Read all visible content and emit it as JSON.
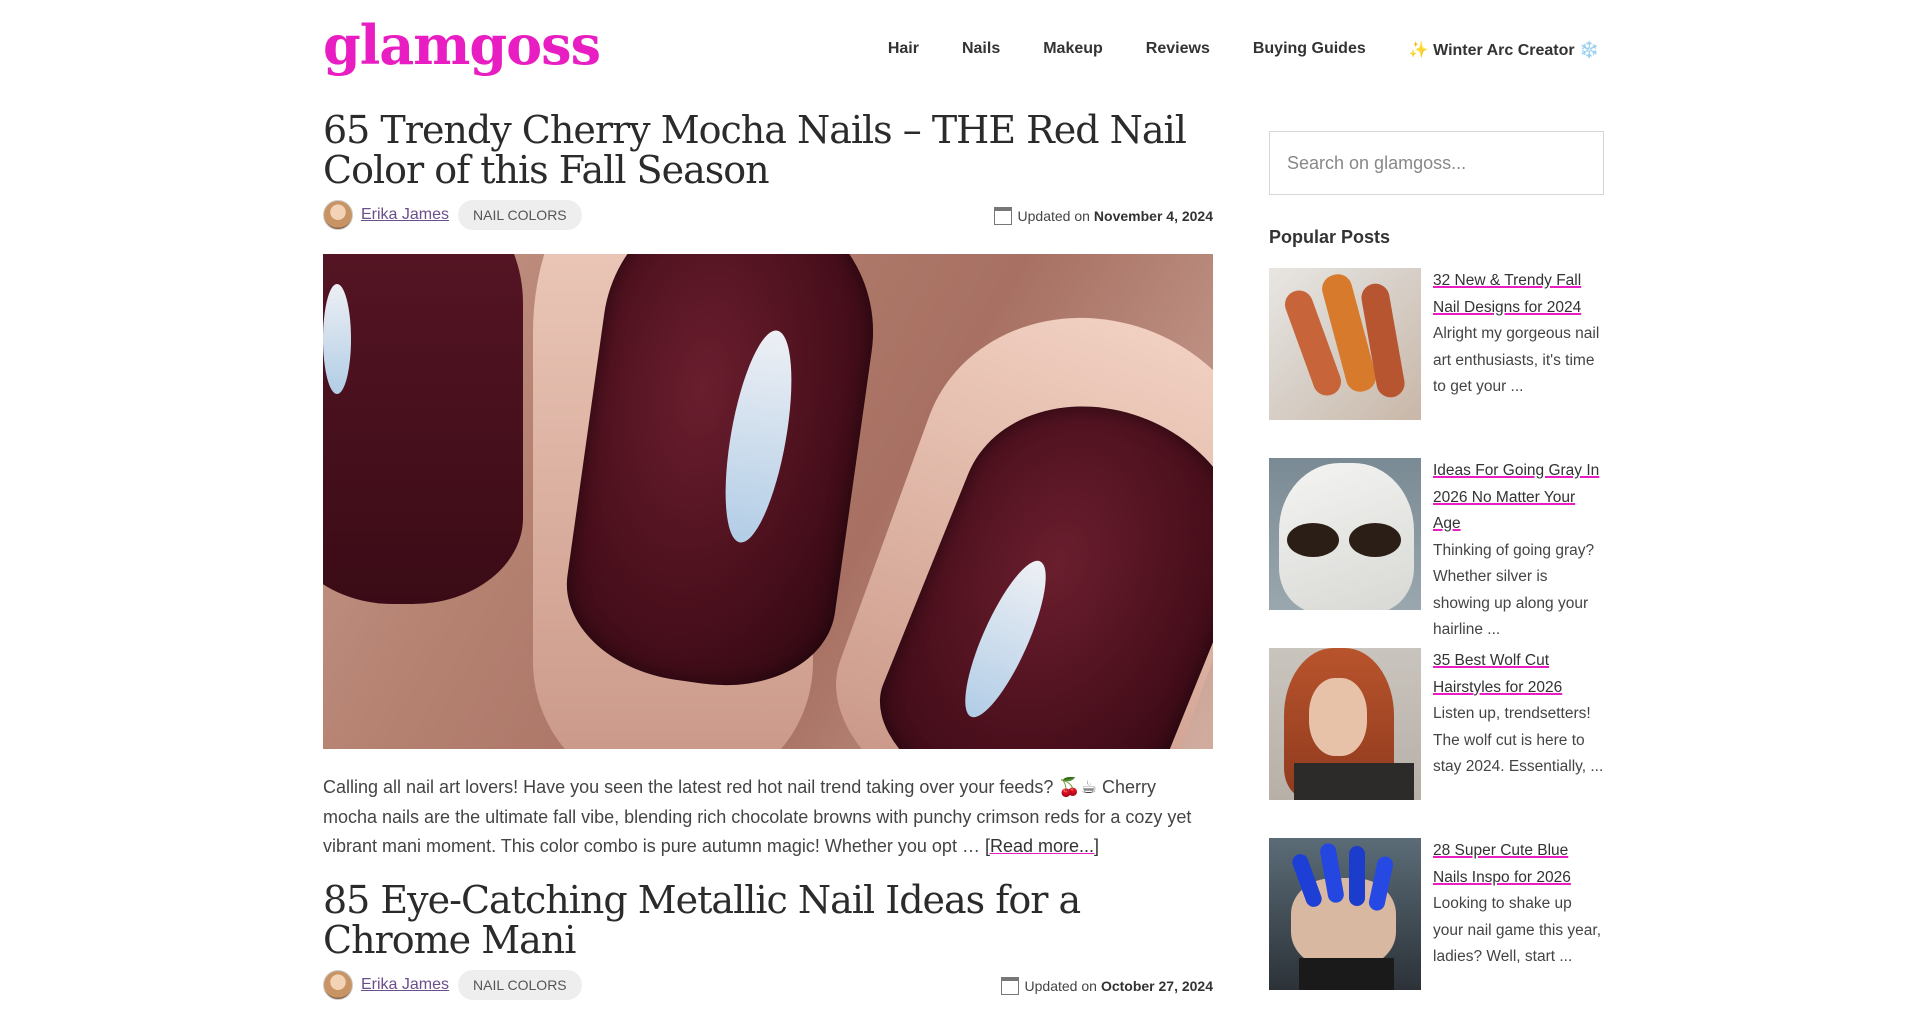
{
  "site": {
    "logo": "glamgoss"
  },
  "nav": {
    "items": [
      {
        "label": "Hair"
      },
      {
        "label": "Nails"
      },
      {
        "label": "Makeup"
      },
      {
        "label": "Reviews"
      },
      {
        "label": "Buying Guides"
      },
      {
        "label": "✨ Winter Arc Creator ❄️"
      }
    ]
  },
  "posts": [
    {
      "title": "65 Trendy Cherry Mocha Nails – THE Red Nail Color of this Fall Season",
      "author": "Erika James",
      "category": "NAIL COLORS",
      "updated_label": "Updated on",
      "updated_date": "November 4, 2024",
      "excerpt": "Calling all nail art lovers! Have you seen the latest red hot nail trend taking over your feeds? 🍒☕ Cherry mocha nails are the ultimate fall vibe, blending rich chocolate browns with punchy crimson reds for a cozy yet vibrant mani moment. This color combo is pure autumn magic! Whether you opt …",
      "read_more": "[Read more...]"
    },
    {
      "title": "85 Eye-Catching Metallic Nail Ideas for a Chrome Mani",
      "author": "Erika James",
      "category": "NAIL COLORS",
      "updated_label": "Updated on",
      "updated_date": "October 27, 2024"
    }
  ],
  "sidebar": {
    "search_placeholder": "Search on glamgoss...",
    "popular_heading": "Popular Posts",
    "popular": [
      {
        "title": "32 New & Trendy Fall Nail Designs for 2024",
        "excerpt": "Alright my gorgeous nail art enthusiasts, it's time to get your ..."
      },
      {
        "title": "Ideas For Going Gray In 2026 No Matter Your Age",
        "excerpt": "Thinking of going gray? Whether silver is showing up along your hairline ..."
      },
      {
        "title": "35 Best Wolf Cut Hairstyles for 2026",
        "excerpt": "Listen up, trendsetters! The wolf cut is here to stay 2024. Essentially, ..."
      },
      {
        "title": "28 Super Cute Blue Nails Inspo for 2026",
        "excerpt": "Looking to shake up your nail game this year, ladies? Well, start ..."
      }
    ]
  },
  "colors": {
    "brand": "#e91ec2",
    "author_link": "#6b4f8a",
    "tag_bg": "#eeeeee"
  }
}
